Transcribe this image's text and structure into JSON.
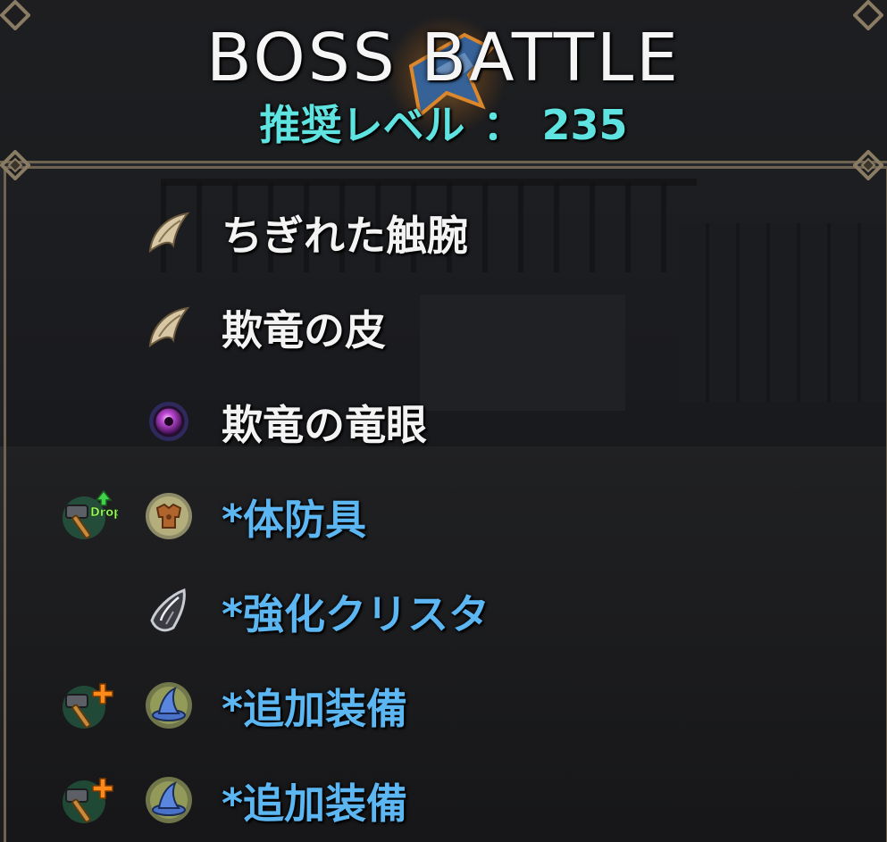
{
  "header": {
    "title": "BOSS BATTLE",
    "level_label": "推奨レベル",
    "level_separator": "：",
    "level_value": "235"
  },
  "items": [
    {
      "label": "ちぎれた触腕",
      "icon": "claw-icon",
      "left_icon": "",
      "color": "white"
    },
    {
      "label": "欺竜の皮",
      "icon": "claw-icon",
      "left_icon": "",
      "color": "white"
    },
    {
      "label": "欺竜の竜眼",
      "icon": "purple-orb-icon",
      "left_icon": "",
      "color": "white"
    },
    {
      "label": "*体防具",
      "icon": "body-armor-icon",
      "left_icon": "hammer-drop-up-icon",
      "left_badge": "Drop",
      "color": "blue"
    },
    {
      "label": "*強化クリスタ",
      "icon": "crystal-icon",
      "left_icon": "",
      "color": "blue"
    },
    {
      "label": "*追加装備",
      "icon": "wizard-hat-icon",
      "left_icon": "hammer-plus-icon",
      "color": "blue"
    },
    {
      "label": "*追加装備",
      "icon": "wizard-hat-icon",
      "left_icon": "hammer-plus-icon",
      "color": "blue"
    }
  ],
  "colors": {
    "white_text": "#f3f3f3",
    "blue_text": "#5bb6f2",
    "level_text": "#5fe3e0",
    "frame": "#6e6250"
  }
}
